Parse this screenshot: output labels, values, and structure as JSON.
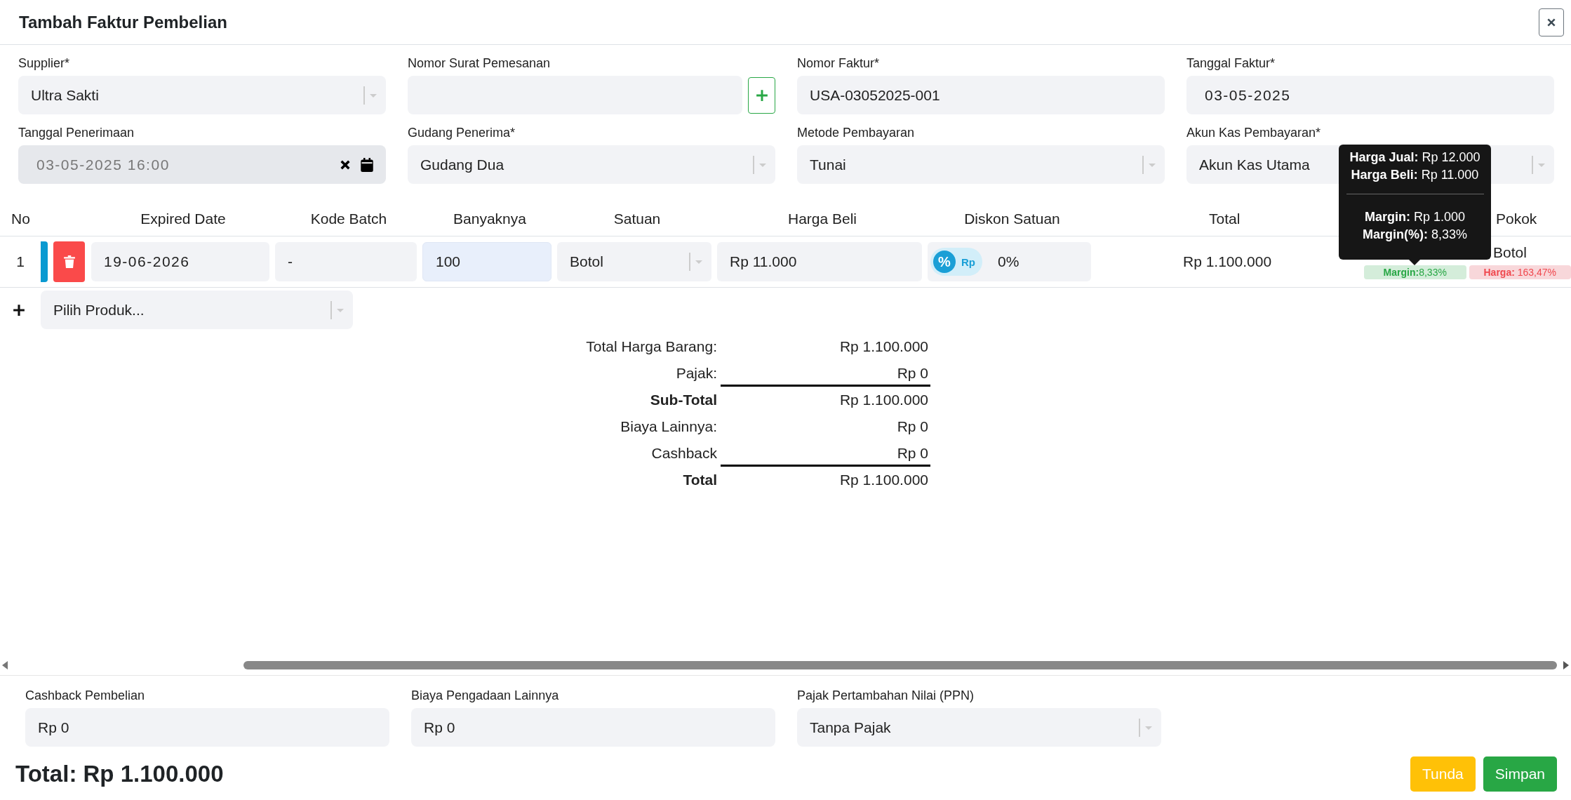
{
  "dialog": {
    "title": "Tambah Faktur Pembelian"
  },
  "fields": [
    {
      "label": "Supplier*",
      "kind": "select",
      "value": "Ultra Sakti",
      "disabled": false
    },
    {
      "label": "Nomor Surat Pemesanan",
      "kind": "text_add",
      "disabled": false
    },
    {
      "label": "Nomor Faktur*",
      "kind": "text",
      "value": "USA-03052025-001",
      "disabled": false
    },
    {
      "label": "Tanggal Faktur*",
      "kind": "date",
      "value": "03-05-2025",
      "disabled": false
    },
    {
      "label": "Tanggal Penerimaan",
      "kind": "datetime",
      "value": "03-05-2025 16:00",
      "disabled": true
    },
    {
      "label": "Gudang Penerima*",
      "kind": "select",
      "value": "Gudang Dua",
      "disabled": false
    },
    {
      "label": "Metode Pembayaran",
      "kind": "select",
      "value": "Tunai",
      "disabled": false
    },
    {
      "label": "Akun Kas Pembayaran*",
      "kind": "select",
      "value": "Akun Kas Utama",
      "disabled": false
    }
  ],
  "table": {
    "columns": [
      "No",
      "Expired Date",
      "Kode Batch",
      "Banyaknya",
      "Satuan",
      "Harga Beli",
      "Diskon Satuan",
      "Total",
      "Pokok"
    ],
    "rows": [
      {
        "no": "1",
        "expired_date": "19-06-2026",
        "kode_batch": "-",
        "banyaknya": "100",
        "banyaknya_focused": true,
        "satuan": "Botol",
        "harga_beli": "Rp 11.000",
        "discount_toggle": [
          {
            "label": "%",
            "selected": true
          },
          {
            "label": "Rp",
            "selected": false
          }
        ],
        "diskon": "0%",
        "total": "Rp 1.100.000",
        "analisis": "Botol",
        "badges": [
          {
            "text": "**Margin:**8,33%",
            "kind": "good"
          },
          {
            "text": "**Harga:** 163,47%",
            "kind": "bad"
          }
        ],
        "tooltip": {
          "lines": [
            "**Harga Jual:** Rp 12.000",
            "**Harga Beli:** Rp 11.000"
          ],
          "lines_after_divider": [
            "**Margin:** Rp 1.000",
            "**Margin(%):** 8,33%"
          ]
        }
      }
    ],
    "add_product": {
      "placeholder": "Pilih Produk..."
    }
  },
  "summary": [
    {
      "label": "Total Harga Barang:",
      "value": "Rp 1.100.000",
      "bold": false,
      "rule_below": false
    },
    {
      "label": "Pajak:",
      "value": "Rp 0",
      "bold": false,
      "rule_below": true
    },
    {
      "label": "Sub-Total",
      "value": "Rp 1.100.000",
      "bold": true,
      "rule_below": false
    },
    {
      "label": "Biaya Lainnya:",
      "value": "Rp 0",
      "bold": false,
      "rule_below": false
    },
    {
      "label": "Cashback",
      "value": "Rp 0",
      "bold": false,
      "rule_below": true
    },
    {
      "label": "Total",
      "value": "Rp 1.100.000",
      "bold": true,
      "rule_below": false
    }
  ],
  "bottom_fields": [
    {
      "label": "Cashback Pembelian",
      "kind": "text",
      "value": "Rp 0"
    },
    {
      "label": "Biaya Pengadaan Lainnya",
      "kind": "text",
      "value": "Rp 0"
    },
    {
      "label": "Pajak Pertambahan Nilai (PPN)",
      "kind": "select",
      "value": "Tanpa Pajak"
    }
  ],
  "grand_total": "Total: Rp 1.100.000",
  "buttons": [
    {
      "label": "Tunda",
      "kind": "warning"
    },
    {
      "label": "Simpan",
      "kind": "success"
    }
  ]
}
